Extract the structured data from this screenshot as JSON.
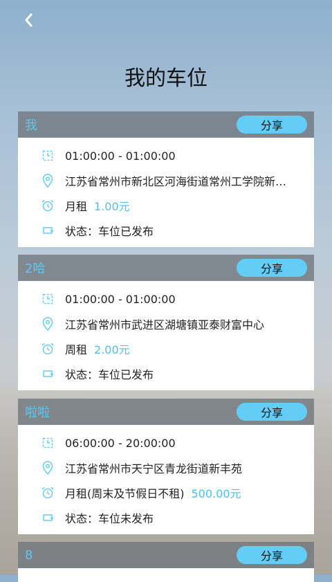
{
  "header": {
    "title": "我的车位"
  },
  "colors": {
    "accent": "#63cdf6",
    "price": "#4fc0ee",
    "header_bar": "#70767c"
  },
  "share_label": "分享",
  "cards": [
    {
      "name": "我",
      "time": "01:00:00 - 01:00:00",
      "address": "江苏省常州市新北区河海街道常州工学院新…",
      "rent_type": "月租",
      "price": "1.00元",
      "status": "状态：车位已发布"
    },
    {
      "name": "2哈",
      "time": "01:00:00 - 01:00:00",
      "address": "江苏省常州市武进区湖塘镇亚泰财富中心",
      "rent_type": "周租",
      "price": "2.00元",
      "status": "状态：车位已发布"
    },
    {
      "name": "啦啦",
      "time": "06:00:00 - 20:00:00",
      "address": "江苏省常州市天宁区青龙街道新丰苑",
      "rent_type": "月租(周末及节假日不租)",
      "price": "500.00元",
      "status": "状态：车位未发布"
    },
    {
      "name": "8"
    }
  ]
}
